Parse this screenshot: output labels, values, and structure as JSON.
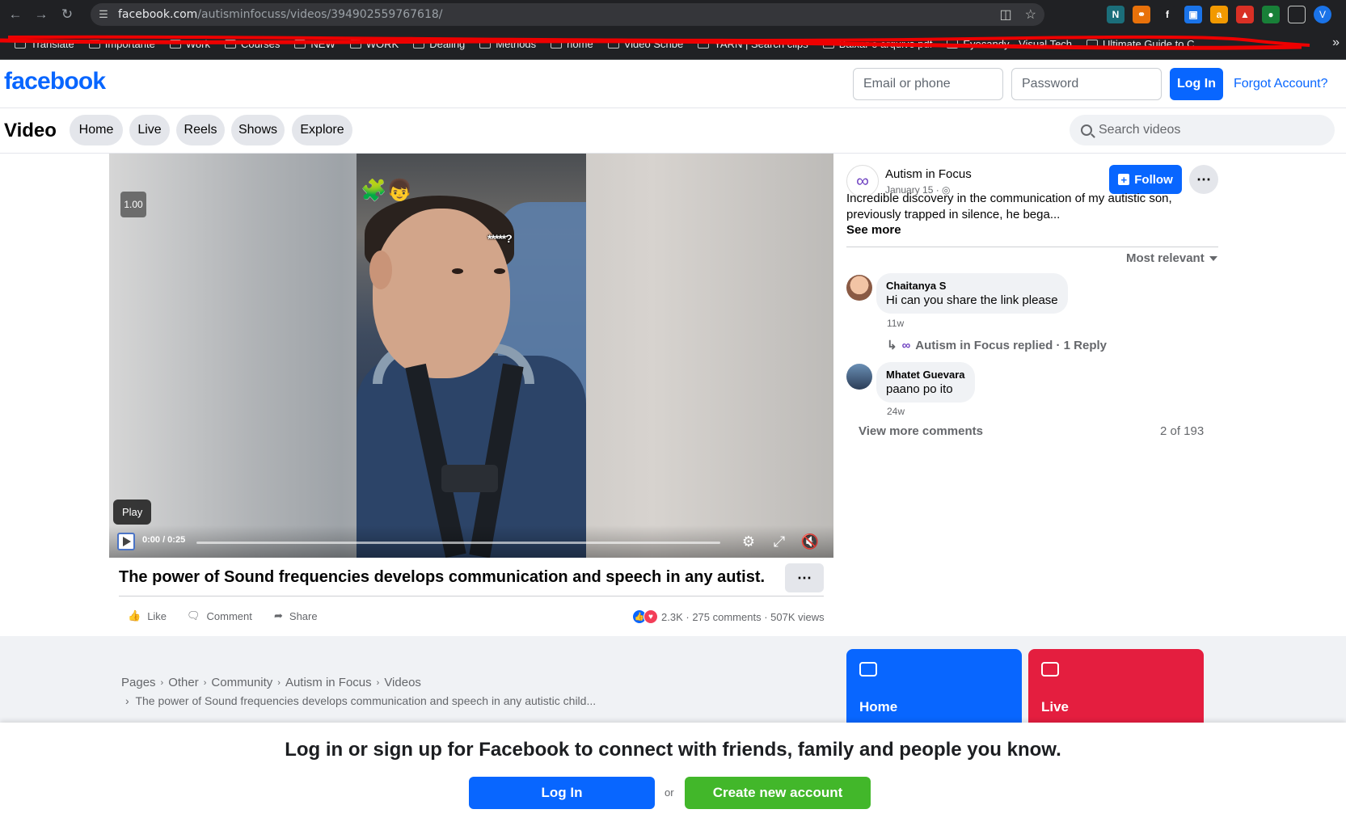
{
  "browser": {
    "url_host": "facebook.com",
    "url_path": "/autisminfocuss/videos/394902559767618/",
    "profile_initial": "V",
    "bookmarks": [
      "Translate",
      "Importante",
      "Work",
      "Courses",
      "NEW",
      "WORK",
      "Dealing",
      "Methods",
      "home",
      "Video Scribe",
      "YARN | Search clips",
      "Baixar o arquivo pdf",
      "Eyecandy - Visual Tech",
      "Ultimate Guide to C..."
    ]
  },
  "fb_header": {
    "logo": "facebook",
    "email_placeholder": "Email or phone",
    "password_placeholder": "Password",
    "login_label": "Log In",
    "forgot_label": "Forgot Account?"
  },
  "video_nav": {
    "title": "Video",
    "tabs": [
      "Home",
      "Live",
      "Reels",
      "Shows",
      "Explore"
    ],
    "search_placeholder": "Search videos"
  },
  "player": {
    "speed_badge": "1.00",
    "play_tooltip": "Play",
    "time": "0:00 / 0:25",
    "overlay_text": "*****?",
    "progress": 0
  },
  "post": {
    "page_name": "Autism in Focus",
    "date": "January 15 ·",
    "follow_label": "Follow",
    "description": "Incredible discovery in the communication of my autistic son, previously trapped in silence, he bega...",
    "see_more": "See more",
    "sort_label": "Most relevant",
    "title": "The power of Sound frequencies develops communication and speech in any autist...",
    "actions": [
      "Like",
      "Comment",
      "Share"
    ],
    "reaction_count": "2.3K",
    "comments_count": "275 comments",
    "views": "507K views"
  },
  "comments": [
    {
      "author": "Chaitanya S",
      "text": "Hi can you share the link please",
      "age": "11w"
    },
    {
      "author": "Mhatet Guevara",
      "text": "paano po ito",
      "age": "24w"
    }
  ],
  "reply_line": "Autism in Focus replied · 1 Reply",
  "view_more": "View more comments",
  "pagination": "2 of 193",
  "breadcrumbs": [
    "Pages",
    "Other",
    "Community",
    "Autism in Focus",
    "Videos"
  ],
  "breadcrumb_tail": "The power of Sound frequencies develops communication and speech in any autistic child...",
  "tiles": [
    {
      "label": "Home",
      "color": "#0866ff"
    },
    {
      "label": "Live",
      "color": "#e41e3f"
    }
  ],
  "banner": {
    "text": "Log in or sign up for Facebook to connect with friends, family and people you know.",
    "login": "Log In",
    "or": "or",
    "create": "Create new account"
  },
  "colors": {
    "fb_blue": "#0866ff",
    "create_green": "#42b72a"
  }
}
